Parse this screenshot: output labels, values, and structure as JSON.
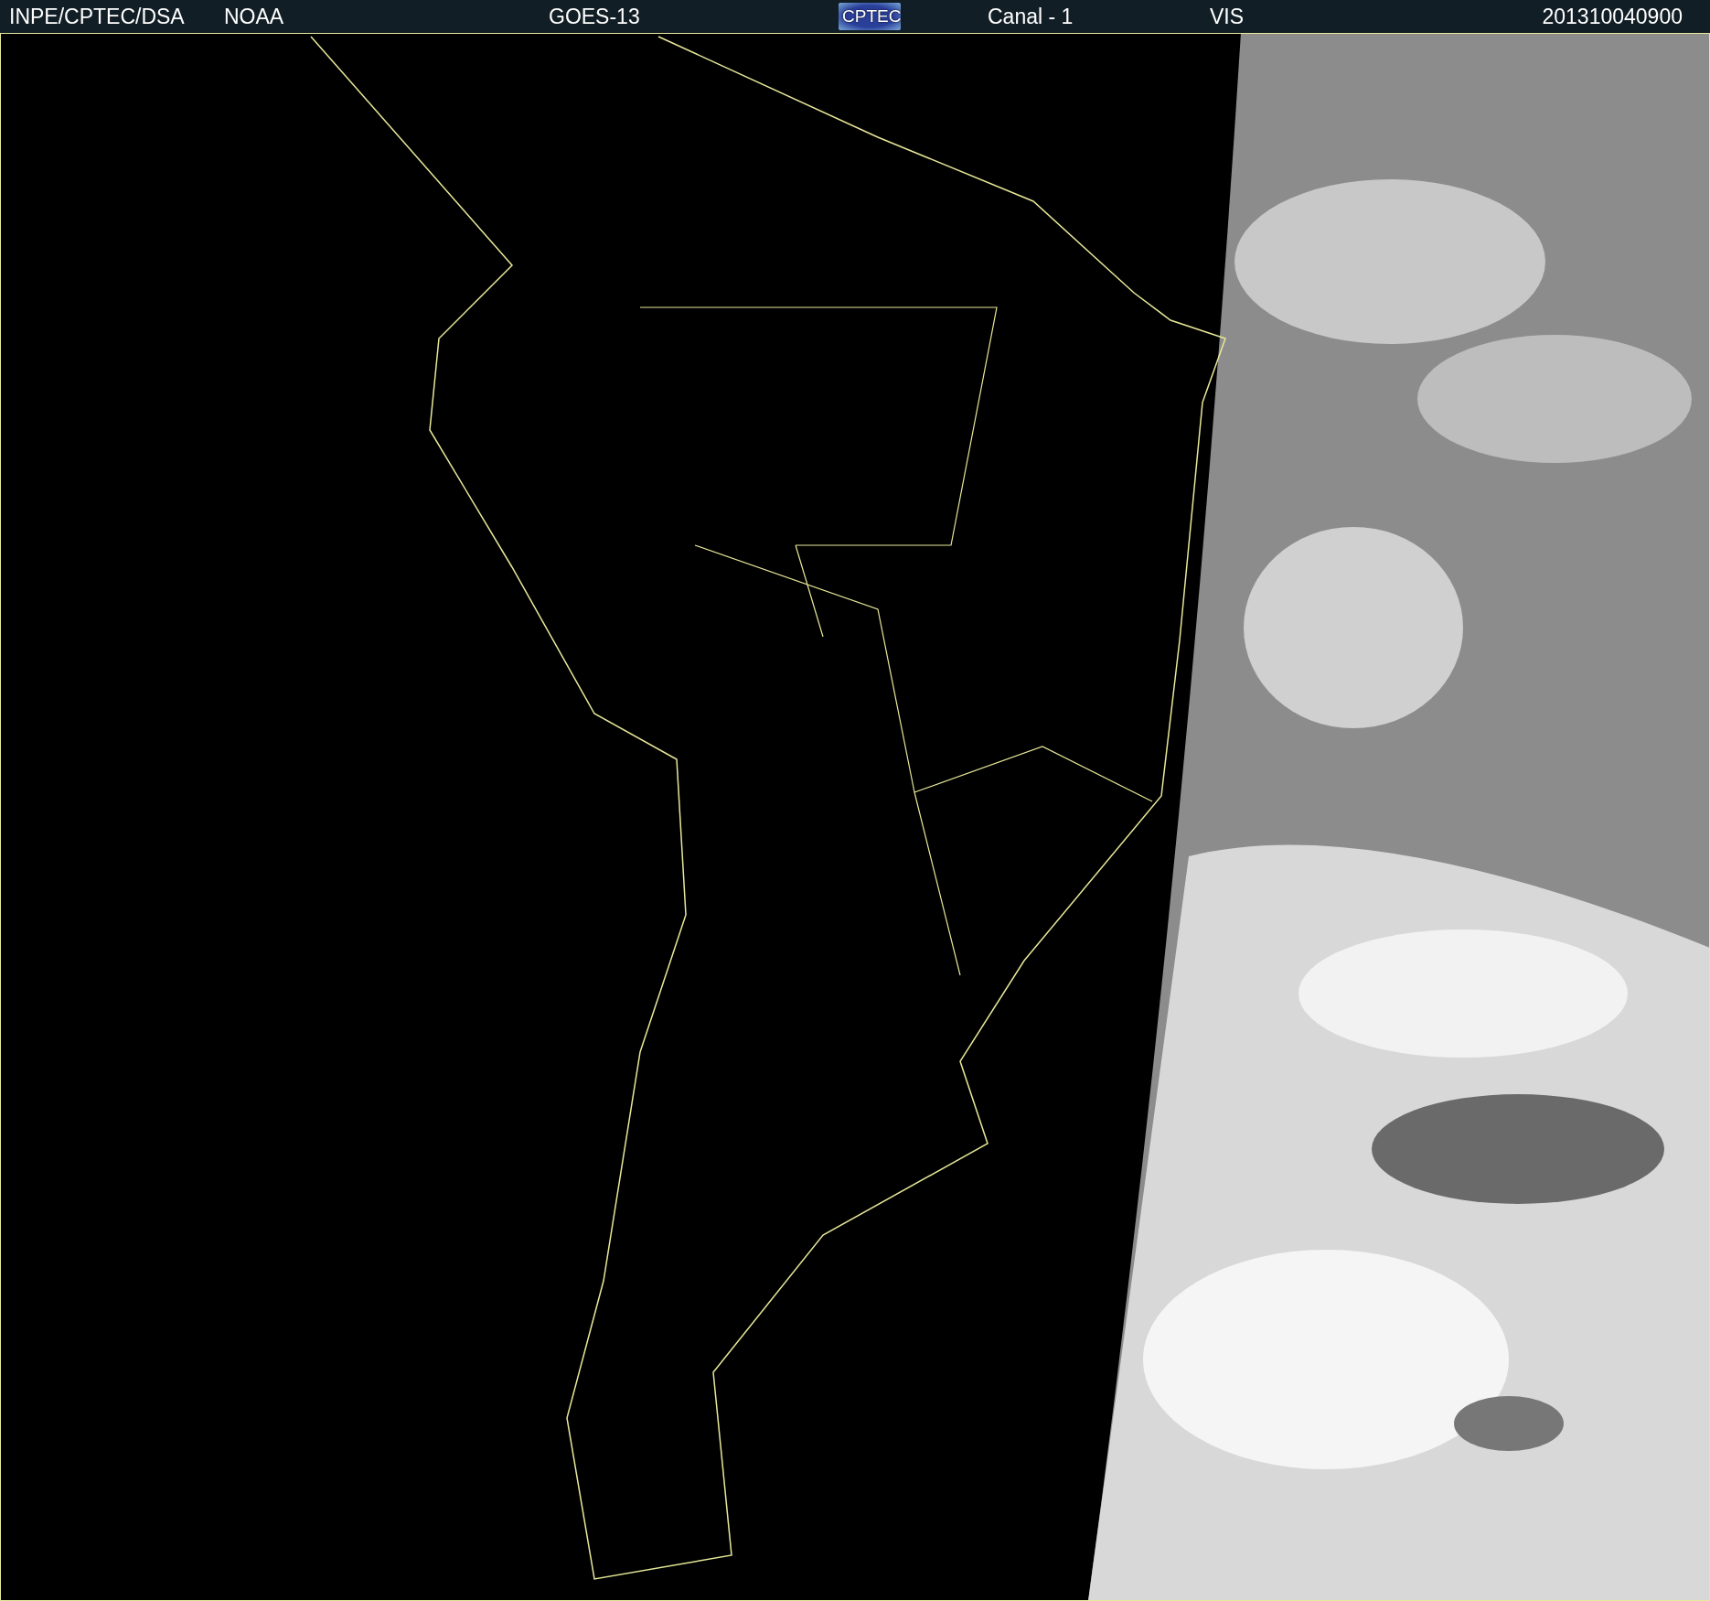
{
  "header": {
    "source": "INPE/CPTEC/DSA",
    "agency": "NOAA",
    "satellite": "GOES-13",
    "logo": "CPTEC",
    "channel": "Canal - 1",
    "band": "VIS",
    "timestamp": "201310040900"
  }
}
